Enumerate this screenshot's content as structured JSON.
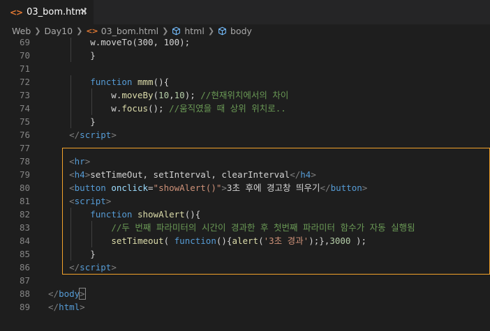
{
  "tab": {
    "icon": "<>",
    "label": "03_bom.html",
    "close": "✕"
  },
  "breadcrumb": {
    "items": [
      "Web",
      "Day10",
      "03_bom.html",
      "html",
      "body"
    ],
    "file_icon": "<>"
  },
  "lines": [
    {
      "n": "69",
      "tokens": [
        [
          "pl",
          "        "
        ],
        [
          "pl",
          "w.moveTo(300, 100);"
        ]
      ]
    },
    {
      "n": "70",
      "tokens": [
        [
          "pl",
          "        }"
        ]
      ]
    },
    {
      "n": "71",
      "tokens": []
    },
    {
      "n": "72",
      "tokens": [
        [
          "pl",
          "        "
        ],
        [
          "kw",
          "function"
        ],
        [
          "pl",
          " "
        ],
        [
          "fn",
          "mmm"
        ],
        [
          "pl",
          "(){"
        ]
      ]
    },
    {
      "n": "73",
      "tokens": [
        [
          "pl",
          "            w."
        ],
        [
          "fn",
          "moveBy"
        ],
        [
          "pl",
          "("
        ],
        [
          "num",
          "10"
        ],
        [
          "pl",
          ","
        ],
        [
          "num",
          "10"
        ],
        [
          "pl",
          "); "
        ],
        [
          "cm",
          "//현재위치에서의 차이"
        ]
      ]
    },
    {
      "n": "74",
      "tokens": [
        [
          "pl",
          "            w."
        ],
        [
          "fn",
          "focus"
        ],
        [
          "pl",
          "(); "
        ],
        [
          "cm",
          "//움직였을 때 상위 위치로.."
        ]
      ]
    },
    {
      "n": "75",
      "tokens": [
        [
          "pl",
          "        }"
        ]
      ]
    },
    {
      "n": "76",
      "tokens": [
        [
          "pl",
          "    "
        ],
        [
          "br",
          "</"
        ],
        [
          "tg",
          "script"
        ],
        [
          "br",
          ">"
        ]
      ]
    },
    {
      "n": "77",
      "tokens": []
    },
    {
      "n": "78",
      "tokens": [
        [
          "pl",
          "    "
        ],
        [
          "br",
          "<"
        ],
        [
          "tg",
          "hr"
        ],
        [
          "br",
          ">"
        ]
      ]
    },
    {
      "n": "79",
      "tokens": [
        [
          "pl",
          "    "
        ],
        [
          "br",
          "<"
        ],
        [
          "tg",
          "h4"
        ],
        [
          "br",
          ">"
        ],
        [
          "pl",
          "setTimeOut, setInterval, clearInterval"
        ],
        [
          "br",
          "</"
        ],
        [
          "tg",
          "h4"
        ],
        [
          "br",
          ">"
        ]
      ]
    },
    {
      "n": "80",
      "tokens": [
        [
          "pl",
          "    "
        ],
        [
          "br",
          "<"
        ],
        [
          "tg",
          "button"
        ],
        [
          "pl",
          " "
        ],
        [
          "at",
          "onclick"
        ],
        [
          "pl",
          "="
        ],
        [
          "st",
          "\"showAlert()\""
        ],
        [
          "br",
          ">"
        ],
        [
          "pl",
          "3초 후에 경고창 띄우기"
        ],
        [
          "br",
          "</"
        ],
        [
          "tg",
          "button"
        ],
        [
          "br",
          ">"
        ]
      ]
    },
    {
      "n": "81",
      "tokens": [
        [
          "pl",
          "    "
        ],
        [
          "br",
          "<"
        ],
        [
          "tg",
          "script"
        ],
        [
          "br",
          ">"
        ]
      ]
    },
    {
      "n": "82",
      "tokens": [
        [
          "pl",
          "        "
        ],
        [
          "kw",
          "function"
        ],
        [
          "pl",
          " "
        ],
        [
          "fn",
          "showAlert"
        ],
        [
          "pl",
          "(){"
        ]
      ]
    },
    {
      "n": "83",
      "tokens": [
        [
          "pl",
          "            "
        ],
        [
          "cm",
          "//두 번째 파라미터의 시간이 경과한 후 첫번째 파라미터 함수가 자동 실행됨"
        ]
      ]
    },
    {
      "n": "84",
      "tokens": [
        [
          "pl",
          "            "
        ],
        [
          "fn",
          "setTimeout"
        ],
        [
          "pl",
          "( "
        ],
        [
          "kw",
          "function"
        ],
        [
          "pl",
          "(){"
        ],
        [
          "fn",
          "alert"
        ],
        [
          "pl",
          "("
        ],
        [
          "st",
          "'3초 경과'"
        ],
        [
          "pl",
          ");},"
        ],
        [
          "num",
          "3000"
        ],
        [
          "pl",
          " );"
        ]
      ]
    },
    {
      "n": "85",
      "tokens": [
        [
          "pl",
          "        }"
        ]
      ]
    },
    {
      "n": "86",
      "tokens": [
        [
          "pl",
          "    "
        ],
        [
          "br",
          "</"
        ],
        [
          "tg",
          "script"
        ],
        [
          "br",
          ">"
        ]
      ]
    },
    {
      "n": "87",
      "tokens": []
    },
    {
      "n": "88",
      "tokens": [
        [
          "br",
          "</"
        ],
        [
          "tg",
          "body"
        ],
        [
          "br",
          ">"
        ]
      ]
    },
    {
      "n": "89",
      "tokens": [
        [
          "br",
          "</"
        ],
        [
          "tg",
          "html"
        ],
        [
          "br",
          ">"
        ]
      ]
    }
  ],
  "colors": {
    "editor_bg": "#1e1e1e",
    "keyword": "#569cd6",
    "function": "#dcdcaa",
    "comment": "#6a9955",
    "number": "#b5cea8",
    "string": "#ce9178",
    "attribute": "#9cdcfe",
    "highlight_border": "#f3a22b"
  }
}
